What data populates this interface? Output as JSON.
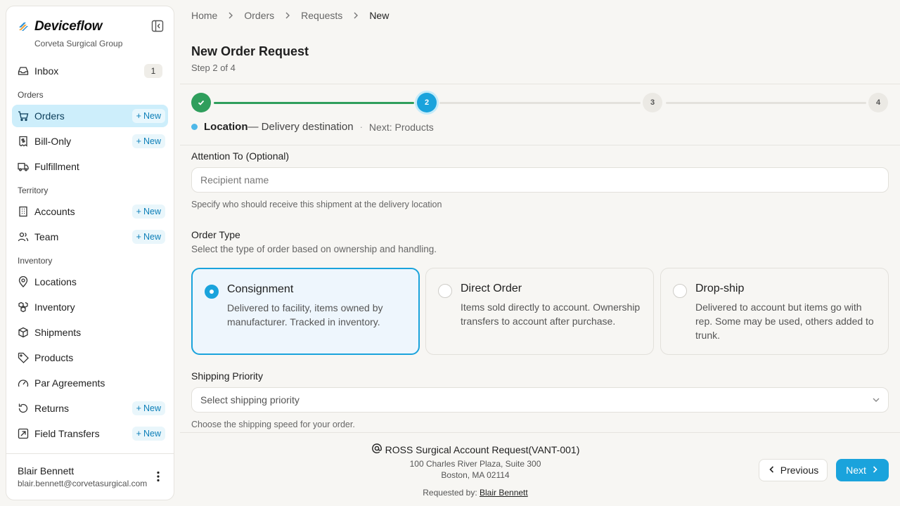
{
  "brand": {
    "title": "Deviceflow",
    "org": "Corveta Surgical Group"
  },
  "sidebar": {
    "inbox": {
      "label": "Inbox",
      "count": "1"
    },
    "sections": {
      "orders": "Orders",
      "territory": "Territory",
      "inventory": "Inventory"
    },
    "new_label": "New",
    "items": {
      "orders": "Orders",
      "bill_only": "Bill-Only",
      "fulfillment": "Fulfillment",
      "accounts": "Accounts",
      "team": "Team",
      "locations": "Locations",
      "inventory": "Inventory",
      "shipments": "Shipments",
      "products": "Products",
      "par_agreements": "Par Agreements",
      "returns": "Returns",
      "field_transfers": "Field Transfers"
    },
    "active_item": "Orders"
  },
  "user": {
    "name": "Blair Bennett",
    "email": "blair.bennett@corvetasurgical.com"
  },
  "breadcrumb": [
    "Home",
    "Orders",
    "Requests",
    "New"
  ],
  "page": {
    "title": "New Order Request",
    "step_text": "Step 2 of 4"
  },
  "stepper": {
    "current_step": 2,
    "total_steps": 4,
    "step_labels": [
      "2",
      "3",
      "4"
    ],
    "caption_title": "Location",
    "caption_desc": "— Delivery destination",
    "caption_sep": "·",
    "caption_next": "Next: Products"
  },
  "form": {
    "attention": {
      "label": "Attention To (Optional)",
      "value": "",
      "placeholder": "Recipient name",
      "help": "Specify who should receive this shipment at the delivery location"
    },
    "order_type": {
      "label": "Order Type",
      "help": "Select the type of order based on ownership and handling.",
      "selected": "Consignment",
      "options": [
        {
          "title": "Consignment",
          "desc": "Delivered to facility, items owned by manufacturer. Tracked in inventory."
        },
        {
          "title": "Direct Order",
          "desc": "Items sold directly to account. Ownership transfers to account after purchase."
        },
        {
          "title": "Drop-ship",
          "desc": "Delivered to account but items go with rep. Some may be used, others added to trunk."
        }
      ]
    },
    "shipping_priority": {
      "label": "Shipping Priority",
      "placeholder": "Select shipping priority",
      "help": "Choose the shipping speed for your order."
    }
  },
  "footer": {
    "location_title": "ROSS Surgical Account Request(VANT-001)",
    "address_line1": "100 Charles River Plaza, Suite 300",
    "address_line2": "Boston, MA 02114",
    "requested_by_label": "Requested by:",
    "requested_by_name": "Blair Bennett",
    "prev_label": "Previous",
    "next_label": "Next"
  },
  "colors": {
    "accent": "#1aa3dc",
    "success": "#2f9e5c",
    "active_nav_bg": "#cdeefb",
    "background": "#f7f6f3"
  }
}
